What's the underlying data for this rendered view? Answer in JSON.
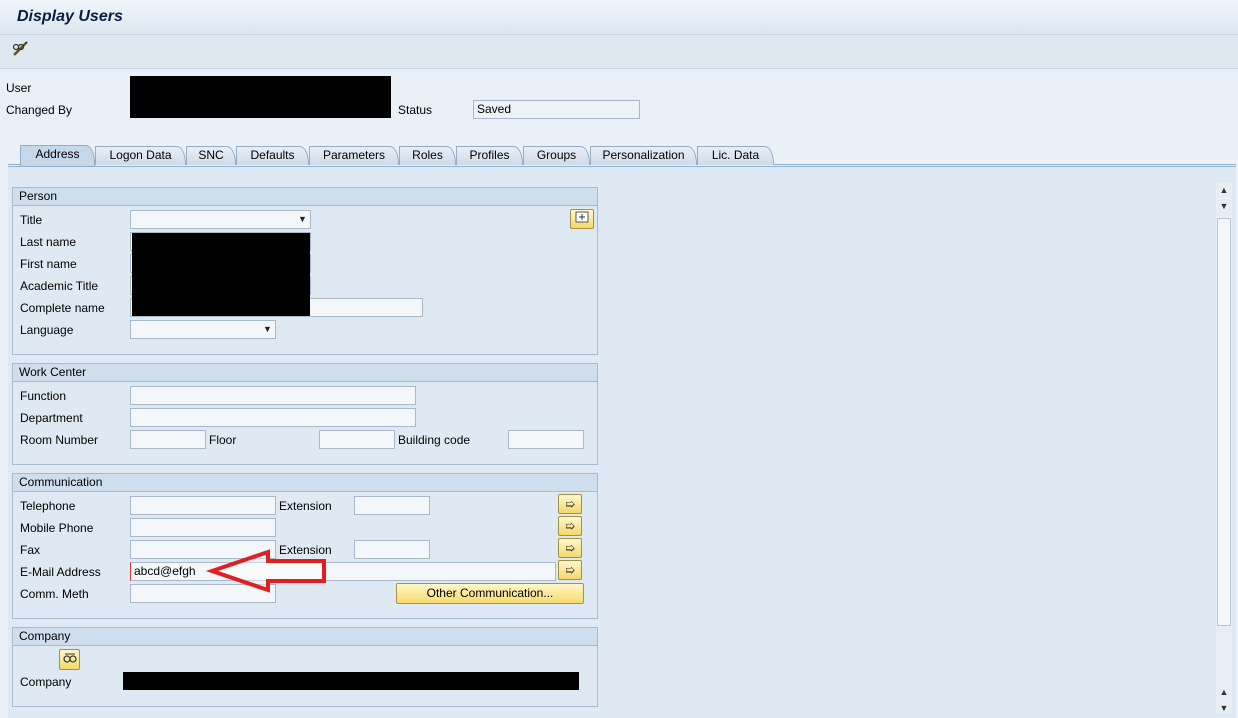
{
  "window": {
    "title": "Display Users"
  },
  "toolbar": {
    "edit_icon": "pencil-glasses-icon"
  },
  "header": {
    "user_label": "User",
    "changed_by_label": "Changed By",
    "status_label": "Status",
    "status_value": "Saved"
  },
  "tabs": [
    "Address",
    "Logon Data",
    "SNC",
    "Defaults",
    "Parameters",
    "Roles",
    "Profiles",
    "Groups",
    "Personalization",
    "Lic. Data"
  ],
  "person": {
    "heading": "Person",
    "title_label": "Title",
    "last_name_label": "Last name",
    "first_name_label": "First name",
    "academic_title_label": "Academic Title",
    "complete_name_label": "Complete name",
    "language_label": "Language"
  },
  "work_center": {
    "heading": "Work Center",
    "function_label": "Function",
    "department_label": "Department",
    "room_label": "Room Number",
    "floor_label": "Floor",
    "building_label": "Building code"
  },
  "communication": {
    "heading": "Communication",
    "telephone_label": "Telephone",
    "extension_label": "Extension",
    "mobile_label": "Mobile Phone",
    "fax_label": "Fax",
    "fax_extension_label": "Extension",
    "email_label": "E-Mail Address",
    "email_value": "abcd@efgh",
    "comm_meth_label": "Comm. Meth",
    "other_comm_button": "Other Communication..."
  },
  "company": {
    "heading": "Company",
    "company_label": "Company"
  },
  "colors": {
    "annotation_arrow": "#e02020"
  }
}
